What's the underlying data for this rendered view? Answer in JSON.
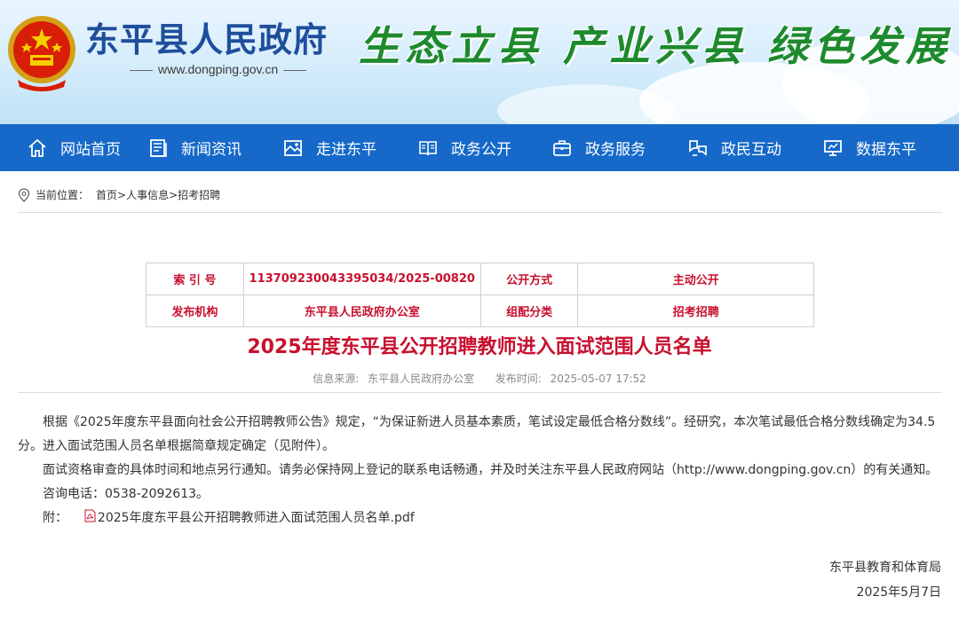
{
  "header": {
    "site_title": "东平县人民政府",
    "site_url": "www.dongping.gov.cn",
    "slogan": "生态立县 产业兴县 绿色发展"
  },
  "nav": {
    "items": [
      {
        "label": "网站首页",
        "icon": "home-icon"
      },
      {
        "label": "新闻资讯",
        "icon": "news-icon"
      },
      {
        "label": "走进东平",
        "icon": "map-icon"
      },
      {
        "label": "政务公开",
        "icon": "book-icon"
      },
      {
        "label": "政务服务",
        "icon": "briefcase-icon"
      },
      {
        "label": "政民互动",
        "icon": "interaction-icon"
      },
      {
        "label": "数据东平",
        "icon": "monitor-icon"
      }
    ]
  },
  "breadcrumb": {
    "prefix": "当前位置：",
    "items": [
      "首页",
      "人事信息",
      "招考招聘"
    ],
    "separator": ">"
  },
  "meta_table": {
    "rows": [
      [
        "索 引 号",
        "113709230043395034/2025-00820",
        "公开方式",
        "主动公开"
      ],
      [
        "发布机构",
        "东平县人民政府办公室",
        "组配分类",
        "招考招聘"
      ]
    ]
  },
  "article": {
    "title": "2025年度东平县公开招聘教师进入面试范围人员名单",
    "source_label": "信息来源:",
    "source_value": "东平县人民政府办公室",
    "time_label": "发布时间:",
    "time_value": "2025-05-07 17:52",
    "paragraphs": [
      "根据《2025年度东平县面向社会公开招聘教师公告》规定，“为保证新进人员基本素质，笔试设定最低合格分数线”。经研究，本次笔试最低合格分数线确定为34.5分。进入面试范围人员名单根据简章规定确定（见附件）。",
      "面试资格审查的具体时间和地点另行通知。请务必保持网上登记的联系电话畅通，并及时关注东平县人民政府网站（http://www.dongping.gov.cn）的有关通知。",
      "咨询电话：0538-2092613。"
    ],
    "attachment_label": "附：",
    "attachment_file": "2025年度东平县公开招聘教师进入面试范围人员名单.pdf",
    "signature_org": "东平县教育和体育局",
    "signature_date": "2025年5月7日"
  },
  "colors": {
    "nav_bg": "#1669c9",
    "title_red": "#c8102e",
    "site_title_blue": "#1f4e9c",
    "slogan_green": "#1d8a2e"
  }
}
